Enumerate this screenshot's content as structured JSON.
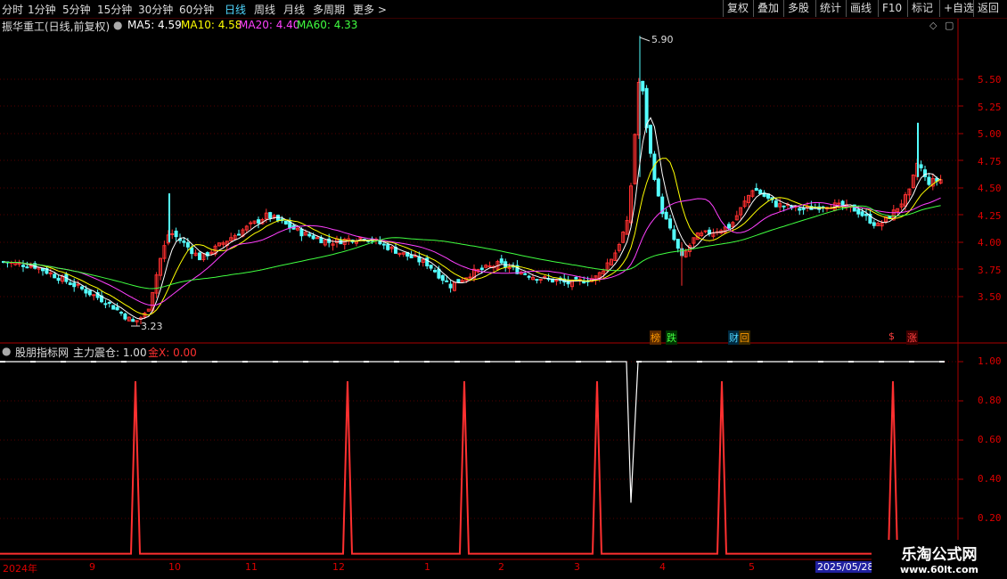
{
  "toolbar": {
    "periods": [
      "分时",
      "1分钟",
      "5分钟",
      "15分钟",
      "30分钟",
      "60分钟",
      "日线",
      "周线",
      "月线",
      "多周期",
      "更多 >"
    ],
    "active_period": "日线",
    "right_buttons": [
      "复权",
      "叠加",
      "多股",
      "统计",
      "画线",
      "F10",
      "标记",
      "+自选",
      "返回"
    ]
  },
  "main_panel": {
    "stock_title": "振华重工(日线,前复权)",
    "indicators": [
      {
        "label": "MA5: 4.59",
        "color": "#ffffff"
      },
      {
        "label": "MA10: 4.58",
        "color": "#ffff00"
      },
      {
        "label": "MA20: 4.40",
        "color": "#ff40ff"
      },
      {
        "label": "MA60: 4.33",
        "color": "#40ff40"
      }
    ],
    "price_ticks": [
      "5.50",
      "5.25",
      "5.00",
      "4.75",
      "4.50",
      "4.25",
      "4.00",
      "3.75",
      "3.50"
    ],
    "high_label": "5.90",
    "low_label": "3.23",
    "markers": [
      {
        "text": "榜",
        "color": "#ff9900",
        "bg": "#5a2a00"
      },
      {
        "text": "跌",
        "color": "#40ff40",
        "bg": "#003300"
      },
      {
        "text": "财",
        "color": "#4fd7ff",
        "bg": "#002a40"
      },
      {
        "text": "回",
        "color": "#ff9900",
        "bg": "#3a2a00"
      },
      {
        "text": "$",
        "color": "#ff4040",
        "bg": "#000000"
      },
      {
        "text": "涨",
        "color": "#ff4040",
        "bg": "#400000"
      }
    ]
  },
  "sub_panel": {
    "indicator_name": "股朋指标网",
    "line1": "主力震仓: 1.00",
    "line2": "金X: 0.00",
    "ticks": [
      "1.00",
      "0.80",
      "0.60",
      "0.40",
      "0.20"
    ]
  },
  "date_axis": {
    "labels": [
      "2024年",
      "9",
      "10",
      "11",
      "12",
      "1",
      "2",
      "3",
      "4",
      "5"
    ],
    "cursor_date": "2025/05/28"
  },
  "watermark": {
    "title": "乐淘公式网",
    "url": "www.60lt.com"
  },
  "chart_data": {
    "type": "candlestick",
    "price_high": 5.9,
    "price_low": 3.23,
    "ylim_main": [
      3.3,
      5.9
    ],
    "ylim_sub": [
      0,
      1.05
    ],
    "ma_latest": {
      "MA5": 4.59,
      "MA10": 4.58,
      "MA20": 4.4,
      "MA60": 4.33
    },
    "sub_series": [
      {
        "name": "主力震仓",
        "value": 1.0,
        "color": "#ffffff"
      },
      {
        "name": "金X",
        "value": 0.0,
        "color": "#ff2020"
      }
    ]
  },
  "colors": {
    "up": "#ff3030",
    "down": "#54ffff",
    "grid": "#550000",
    "axis": "#aa0000"
  }
}
